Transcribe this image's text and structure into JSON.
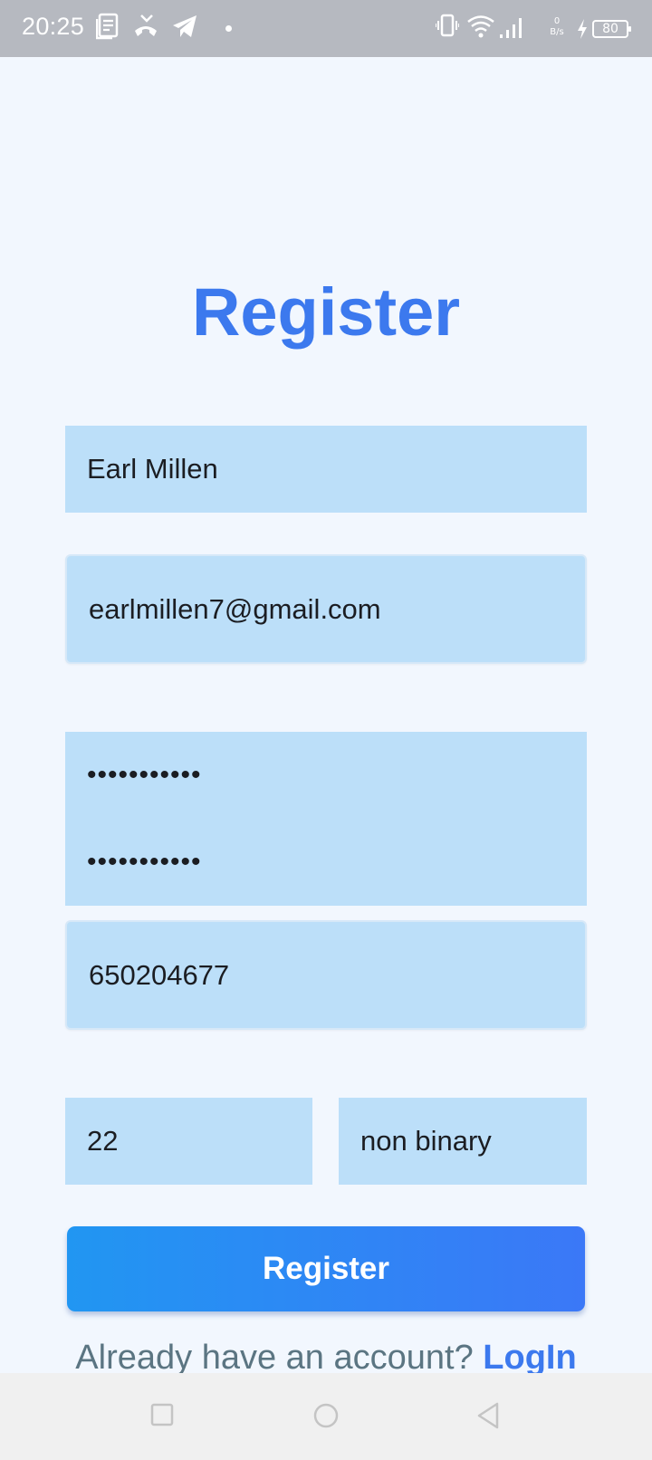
{
  "status_bar": {
    "time": "20:25",
    "net_speed_value": "0",
    "net_speed_unit": "B/s",
    "battery_level": "80",
    "icons": [
      "news-icon",
      "missed-call-icon",
      "telegram-icon",
      "notification-dot-icon",
      "vibrate-icon",
      "wifi-icon",
      "signal-icon",
      "charging-icon",
      "battery-icon"
    ]
  },
  "page": {
    "title": "Register"
  },
  "form": {
    "name_value": "Earl Millen",
    "email_value": "earlmillen7@gmail.com",
    "password_value": "•••••••••••",
    "confirm_password_value": "•••••••••••",
    "phone_value": "650204677",
    "age_value": "22",
    "gender_value": "non binary",
    "submit_label": "Register"
  },
  "footer": {
    "prompt": "Already have an account?",
    "login_label": "LogIn"
  },
  "nav_bar": {
    "icons": [
      "recents-square-icon",
      "home-circle-icon",
      "back-triangle-icon"
    ]
  },
  "colors": {
    "accent": "#3c79ee",
    "field_bg": "#bcdff9",
    "page_bg": "#f2f7fe",
    "status_bar_bg": "#b6b9c0",
    "nav_bar_bg": "#f0f0f0"
  }
}
